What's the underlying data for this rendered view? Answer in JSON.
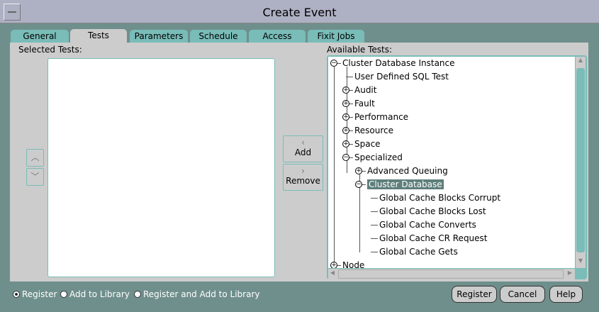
{
  "window": {
    "title": "Create Event"
  },
  "tabs": [
    {
      "label": "General"
    },
    {
      "label": "Tests"
    },
    {
      "label": "Parameters"
    },
    {
      "label": "Schedule"
    },
    {
      "label": "Access"
    },
    {
      "label": "Fixit Jobs"
    }
  ],
  "selected_tests": {
    "label": "Selected Tests:",
    "items": []
  },
  "available_tests": {
    "label": "Available Tests:"
  },
  "buttons": {
    "add": "Add",
    "remove": "Remove",
    "register": "Register",
    "cancel": "Cancel",
    "help": "Help"
  },
  "tree": [
    {
      "label": "Cluster Database Instance",
      "level": 0,
      "state": "expanded"
    },
    {
      "label": "User Defined SQL Test",
      "level": 1,
      "state": "leaf"
    },
    {
      "label": "Audit",
      "level": 1,
      "state": "collapsed"
    },
    {
      "label": "Fault",
      "level": 1,
      "state": "collapsed"
    },
    {
      "label": "Performance",
      "level": 1,
      "state": "collapsed"
    },
    {
      "label": "Resource",
      "level": 1,
      "state": "collapsed"
    },
    {
      "label": "Space",
      "level": 1,
      "state": "collapsed"
    },
    {
      "label": "Specialized",
      "level": 1,
      "state": "expanded"
    },
    {
      "label": "Advanced Queuing",
      "level": 2,
      "state": "collapsed"
    },
    {
      "label": "Cluster Database",
      "level": 2,
      "state": "expanded",
      "selected": true
    },
    {
      "label": "Global Cache Blocks Corrupt",
      "level": 3,
      "state": "leaf"
    },
    {
      "label": "Global Cache Blocks Lost",
      "level": 3,
      "state": "leaf"
    },
    {
      "label": "Global Cache Converts",
      "level": 3,
      "state": "leaf"
    },
    {
      "label": "Global Cache CR Request",
      "level": 3,
      "state": "leaf"
    },
    {
      "label": "Global Cache Gets",
      "level": 3,
      "state": "leaf"
    },
    {
      "label": "Node",
      "level": 0,
      "state": "collapsed"
    }
  ],
  "options": [
    {
      "label": "Register",
      "selected": true
    },
    {
      "label": "Add to Library",
      "selected": false
    },
    {
      "label": "Register and Add to Library",
      "selected": false
    }
  ]
}
